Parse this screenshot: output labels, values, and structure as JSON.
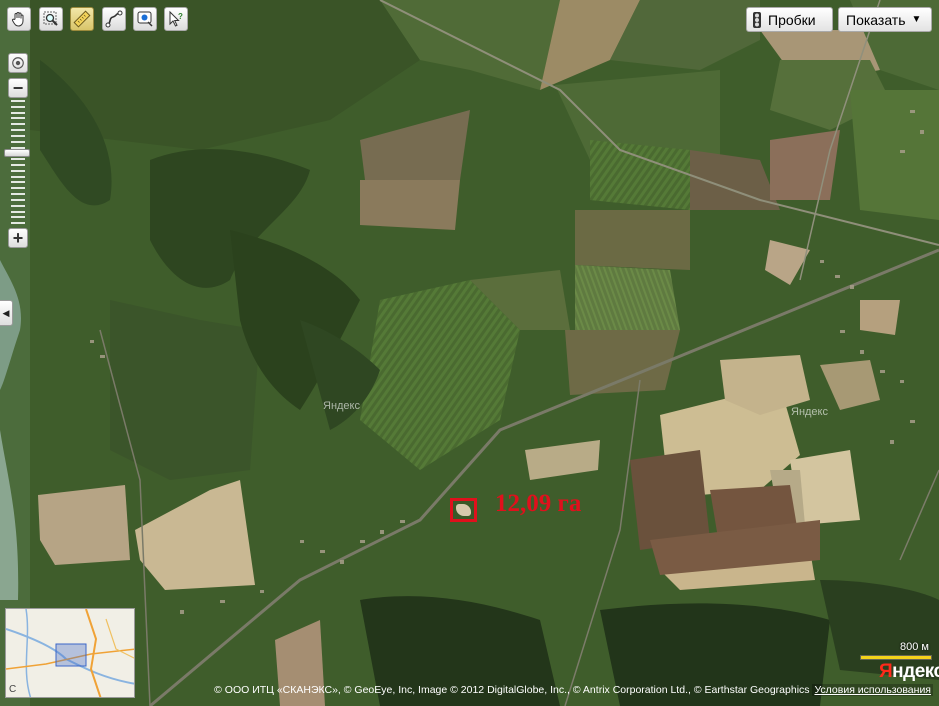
{
  "toolbar": {
    "tools": [
      {
        "icon": "hand-icon",
        "active": false
      },
      {
        "icon": "zoom-box-icon",
        "active": false
      },
      {
        "icon": "ruler-icon",
        "active": true
      },
      {
        "icon": "route-icon",
        "active": false
      },
      {
        "icon": "add-marker-icon",
        "active": false
      },
      {
        "icon": "info-pointer-icon",
        "active": false
      }
    ]
  },
  "controls": {
    "traffic_label": "Пробки",
    "show_label": "Показать",
    "zoom_in": "+",
    "zoom_out": "−",
    "zoom_level_fraction": 0.62
  },
  "annotation": {
    "area_label": "12,09 га",
    "color": "#e0101c"
  },
  "watermarks": [
    "Яндекс",
    "Яндекс"
  ],
  "scale": {
    "label": "800 м",
    "color": "#f4d31a"
  },
  "logo": {
    "first": "Я",
    "rest": "ндекс"
  },
  "minimap": {
    "corner_label": "С"
  },
  "copyright": {
    "text": "© ООО ИТЦ «СКАНЭКС», © GeoEye, Inc, Image © 2012 DigitalGlobe, Inc., © Antrix Corporation Ltd., © Earthstar Geographics",
    "terms_link": "Условия использования"
  }
}
